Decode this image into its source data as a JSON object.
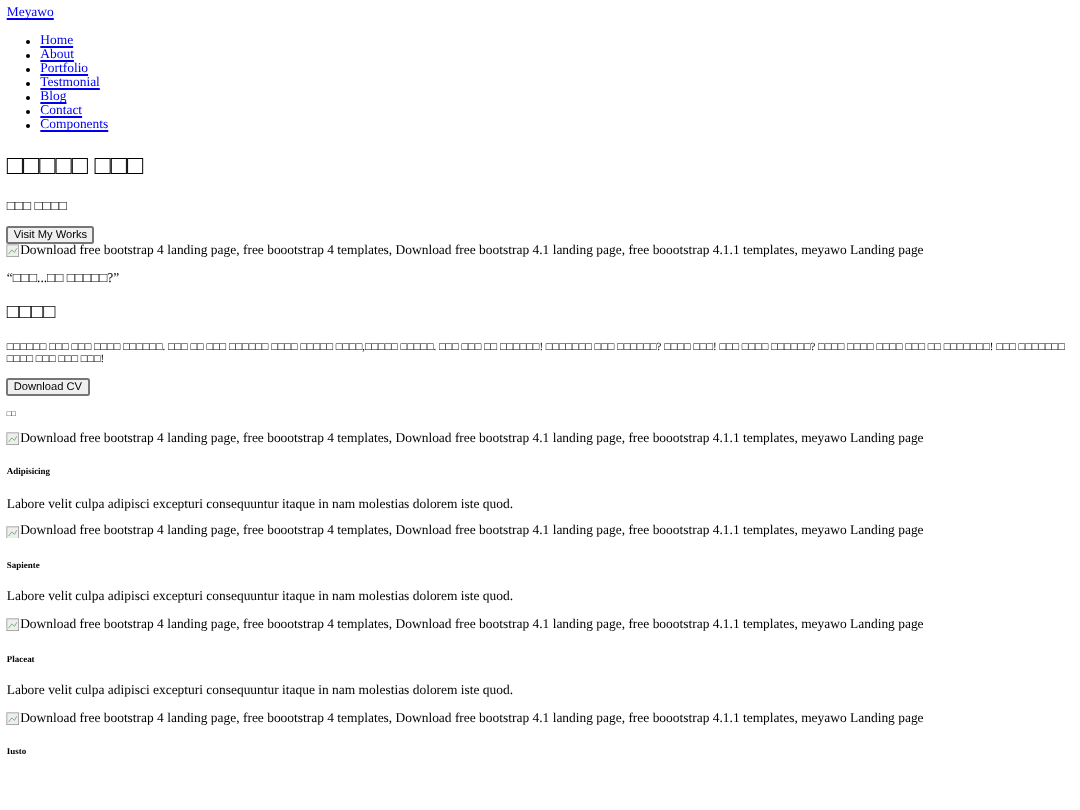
{
  "brand": "Meyawo",
  "nav": [
    "Home",
    "About",
    "Portfolio",
    "Testmonial",
    "Blog",
    "Contact",
    "Components"
  ],
  "hero": {
    "title": "□□□□□ □□□",
    "subtitle": "□□□ □□□□",
    "button": "Visit My Works",
    "image_alt": "Download free bootstrap 4 landing page, free boootstrap 4 templates, Download free bootstrap 4.1 landing page, free boootstrap 4.1.1 templates, meyawo Landing page"
  },
  "about": {
    "quote": "“□□□...□□ □□□□□?”",
    "title": "□□□□",
    "text": "□□□□□□ □□□ □□□ □□□□ □□□□□□. □□□ □□ □□□ □□□□□□ □□□□ □□□□□ □□□□,□□□□□ □□□□□. □□□ □□□ □□ □□□□□□! □□□□□□□ □□□ □□□□□□? □□□□ □□□! □□□ □□□□ □□□□□□? □□□□ □□□□ □□□□ □□□ □□ □□□□□□□! □□□ □□□□□□□ □□□□ □□□ □□□ □□□!",
    "button": "Download CV"
  },
  "portfolio_label": "□□",
  "portfolio": [
    {
      "image_alt": "Download free bootstrap 4 landing page, free boootstrap 4 templates, Download free bootstrap 4.1 landing page, free boootstrap 4.1.1 templates, meyawo Landing page",
      "title": "Adipisicing",
      "text": "Labore velit culpa adipisci excepturi consequuntur itaque in nam molestias dolorem iste quod."
    },
    {
      "image_alt": "Download free bootstrap 4 landing page, free boootstrap 4 templates, Download free bootstrap 4.1 landing page, free boootstrap 4.1.1 templates, meyawo Landing page",
      "title": "Sapiente",
      "text": "Labore velit culpa adipisci excepturi consequuntur itaque in nam molestias dolorem iste quod."
    },
    {
      "image_alt": "Download free bootstrap 4 landing page, free boootstrap 4 templates, Download free bootstrap 4.1 landing page, free boootstrap 4.1.1 templates, meyawo Landing page",
      "title": "Placeat",
      "text": "Labore velit culpa adipisci excepturi consequuntur itaque in nam molestias dolorem iste quod."
    },
    {
      "image_alt": "Download free bootstrap 4 landing page, free boootstrap 4 templates, Download free bootstrap 4.1 landing page, free boootstrap 4.1.1 templates, meyawo Landing page",
      "title": "Iusto"
    }
  ]
}
